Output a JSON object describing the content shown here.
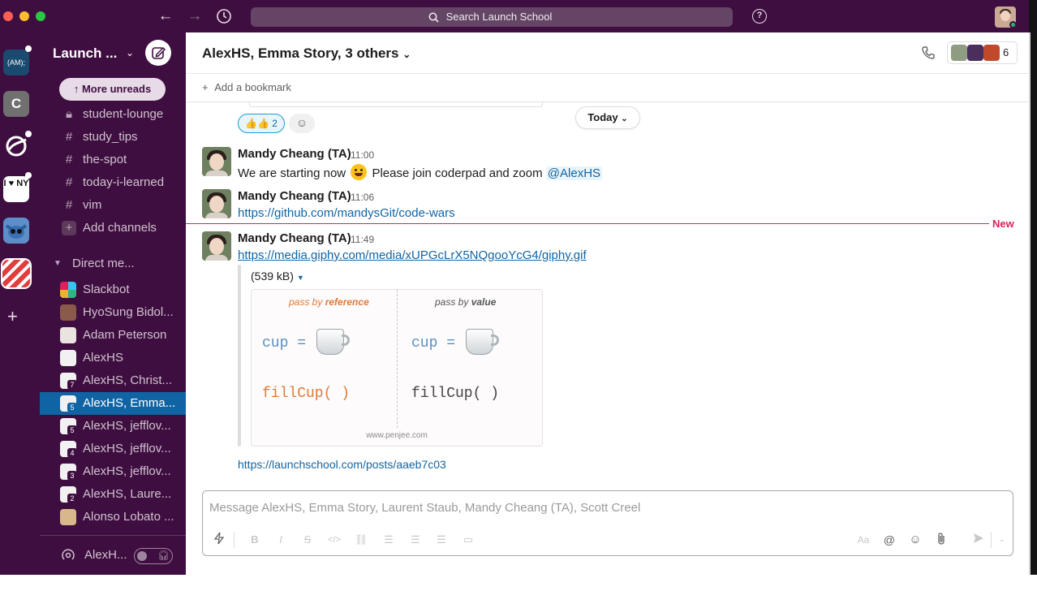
{
  "titlebar": {
    "search_placeholder": "Search Launch School",
    "help_label": "?"
  },
  "rail": {
    "workspaces": [
      {
        "label": "(AM);"
      },
      {
        "label": "C"
      },
      {
        "label": ""
      },
      {
        "label": "I ♥ NY"
      },
      {
        "label": ""
      },
      {
        "label": ""
      }
    ],
    "add_label": "+"
  },
  "sidebar": {
    "workspace_name": "Launch ...",
    "more_unreads": "More unreads",
    "channels": [
      {
        "icon": "lock-icon",
        "label": "student-lounge"
      },
      {
        "icon": "hash-icon",
        "label": "study_tips"
      },
      {
        "icon": "hash-icon",
        "label": "the-spot"
      },
      {
        "icon": "hash-icon",
        "label": "today-i-learned"
      },
      {
        "icon": "hash-icon",
        "label": "vim"
      }
    ],
    "add_channels": "Add channels",
    "dm_section": "Direct me...",
    "dms": [
      {
        "label": "Slackbot",
        "count": ""
      },
      {
        "label": "HyoSung Bidol...",
        "count": ""
      },
      {
        "label": "Adam Peterson",
        "count": ""
      },
      {
        "label": "AlexHS",
        "count": ""
      },
      {
        "label": "AlexHS, Christ...",
        "count": "7"
      },
      {
        "label": "AlexHS, Emma...",
        "count": "5"
      },
      {
        "label": "AlexHS, jefflov...",
        "count": "5"
      },
      {
        "label": "AlexHS, jefflov...",
        "count": "4"
      },
      {
        "label": "AlexHS, jefflov...",
        "count": "3"
      },
      {
        "label": "AlexHS, Laure...",
        "count": "2"
      },
      {
        "label": "Alonso Lobato ...",
        "count": ""
      }
    ],
    "footer_label": "AlexH..."
  },
  "main": {
    "channel_title": "AlexHS, Emma Story, 3 others",
    "member_count": "6",
    "add_bookmark": "Add a bookmark",
    "reaction": {
      "emoji": "👍👍",
      "count": "2"
    },
    "today_label": "Today",
    "new_label": "New",
    "messages": [
      {
        "author": "Mandy Cheang (TA)",
        "time": "11:00",
        "text_before": "We are starting now",
        "text_after": "Please join coderpad and zoom",
        "mention": "@AlexHS"
      },
      {
        "author": "Mandy Cheang (TA)",
        "time": "11:06",
        "link": "https://github.com/mandysGit/code-wars"
      },
      {
        "author": "Mandy Cheang (TA)",
        "time": "11:49",
        "link": "https://media.giphy.com/media/xUPGcLrX5NQgooYcG4/giphy.gif",
        "file_size": "(539 kB)",
        "gif": {
          "left_caption_a": "pass by",
          "left_caption_b": "reference",
          "right_caption_a": "pass by",
          "right_caption_b": "value",
          "cup_label": "cup  =",
          "fill_label": "fillCup(     )",
          "site": "www.penjee.com"
        },
        "extra_link": "https://launchschool.com/posts/aaeb7c03"
      }
    ],
    "composer_placeholder": "Message AlexHS, Emma Story, Laurent Staub, Mandy Cheang (TA), Scott Creel"
  },
  "colors": {
    "aubergine": "#3f0e40",
    "active_blue": "#1164a3",
    "link_blue": "#1264a3",
    "new_red": "#e01e5a"
  }
}
